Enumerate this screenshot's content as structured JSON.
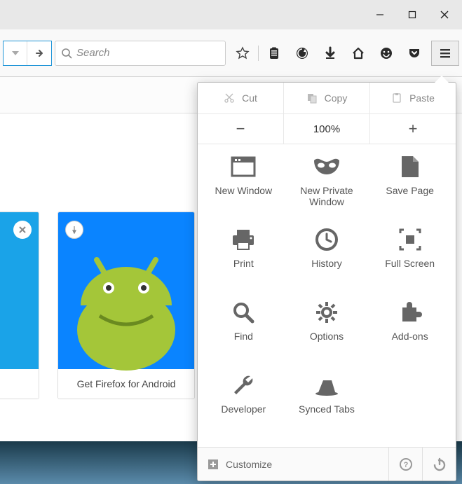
{
  "window": {
    "controls": {
      "minimize": "—",
      "maximize": "▢",
      "close": "✕"
    }
  },
  "toolbar": {
    "search_placeholder": "Search",
    "icons": [
      "star",
      "clipboard",
      "firefox-refresh",
      "download",
      "home",
      "smiley",
      "pocket"
    ]
  },
  "tiles": [
    {
      "caption": ""
    },
    {
      "caption": "Get Firefox for Android"
    }
  ],
  "menu": {
    "edit": {
      "cut": "Cut",
      "copy": "Copy",
      "paste": "Paste"
    },
    "zoom": {
      "minus": "−",
      "level": "100%",
      "plus": "+"
    },
    "items": [
      {
        "key": "new-window",
        "label": "New Window"
      },
      {
        "key": "new-private-window",
        "label": "New Private Window"
      },
      {
        "key": "save-page",
        "label": "Save Page"
      },
      {
        "key": "print",
        "label": "Print"
      },
      {
        "key": "history",
        "label": "History"
      },
      {
        "key": "full-screen",
        "label": "Full Screen"
      },
      {
        "key": "find",
        "label": "Find"
      },
      {
        "key": "options",
        "label": "Options"
      },
      {
        "key": "add-ons",
        "label": "Add-ons"
      },
      {
        "key": "developer",
        "label": "Developer"
      },
      {
        "key": "synced-tabs",
        "label": "Synced Tabs"
      }
    ],
    "footer": {
      "customize": "Customize",
      "help": "?",
      "exit": "⏻"
    }
  }
}
